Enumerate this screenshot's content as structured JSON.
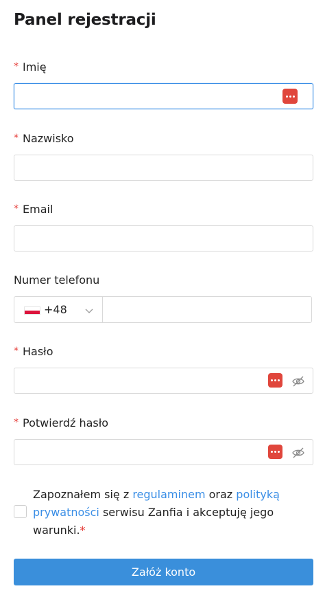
{
  "form": {
    "title": "Panel rejestracji",
    "required_marker": "*",
    "first_name": {
      "label": "Imię",
      "value": ""
    },
    "last_name": {
      "label": "Nazwisko",
      "value": ""
    },
    "email": {
      "label": "Email",
      "value": ""
    },
    "phone": {
      "label": "Numer telefonu",
      "country_code": "+48",
      "value": ""
    },
    "password": {
      "label": "Hasło",
      "value": ""
    },
    "confirm_password": {
      "label": "Potwierdź hasło",
      "value": ""
    },
    "consent": {
      "checked": false,
      "text_1": "Zapoznałem się z ",
      "link_terms": "regulaminem",
      "text_2": " oraz ",
      "link_privacy": "polityką prywatności",
      "text_3": " serwisu Zanfia i akceptuję jego warunki.",
      "star": "*"
    },
    "submit_label": "Załóż konto"
  },
  "icons": {
    "password_manager": "password-manager-icon",
    "toggle_visibility": "eye-off-icon",
    "dropdown": "chevron-down-icon",
    "flag": "poland-flag-icon"
  },
  "colors": {
    "accent": "#3a8fdb",
    "link": "#3a8ee6",
    "required": "#e53935",
    "password_manager": "#e0463c"
  }
}
